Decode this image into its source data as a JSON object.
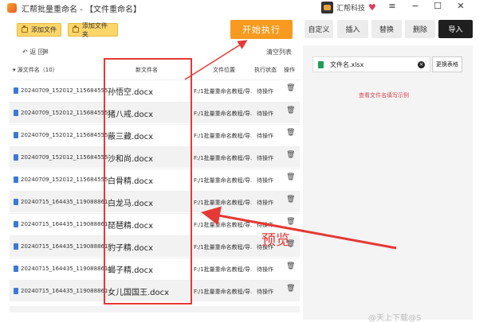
{
  "window": {
    "title": "汇帮批量重命名 - 【文件重命名】",
    "brand": "汇帮科技",
    "controls": {
      "menu": "≡",
      "minimize": "−",
      "maximize": "☐",
      "close": "✕"
    }
  },
  "toolbar": {
    "add_file": "添加文件",
    "add_folder": "添加文件夹",
    "start": "开始执行"
  },
  "tabs": [
    "自定义",
    "插入",
    "替换",
    "删除",
    "导入"
  ],
  "list": {
    "back": "返 回",
    "grid_icon": "⊞",
    "clear": "清空列表",
    "headers": {
      "original": "▾ 源文件名（10）",
      "new_name": "新文件名",
      "location": "文件位置",
      "status": "执行状态",
      "action": "操作"
    },
    "rows": [
      {
        "original": "20240709_152012_115684555",
        "new_name": "孙悟空.docx",
        "location": "F:/1批量重命名教程/导.",
        "status": "待操作",
        "trash": "🗑"
      },
      {
        "original": "20240709_152012_115684555",
        "new_name": "猪八戒.docx",
        "location": "F:/1批量重命名教程/导.",
        "status": "待操作",
        "trash": "🗑"
      },
      {
        "original": "20240709_152012_115684555",
        "new_name": "蔽三藏.docx",
        "location": "F:/1批量重命名教程/导.",
        "status": "待操作",
        "trash": "🗑"
      },
      {
        "original": "20240709_152012_115684555",
        "new_name": "沙和尚.docx",
        "location": "F:/1批量重命名教程/导.",
        "status": "待操作",
        "trash": "🗑"
      },
      {
        "original": "20240709_152012_115684555",
        "new_name": "白骨精.docx",
        "location": "F:/1批量重命名教程/导.",
        "status": "待操作",
        "trash": "🗑"
      },
      {
        "original": "20240715_164435_119088861",
        "new_name": "白龙马.docx",
        "location": "F:/1批量重命名教程/导.",
        "status": "待操作",
        "trash": "🗑"
      },
      {
        "original": "20240715_164435_119088861",
        "new_name": "琵琶精.docx",
        "location": "F:/1批量重命名教程/导.",
        "status": "待操作",
        "trash": "🗑"
      },
      {
        "original": "20240715_164435_119088861",
        "new_name": "豹子精.docx",
        "location": "F:/1批量重命名教程/导.",
        "status": "待操作",
        "trash": "🗑"
      },
      {
        "original": "20240715_164435_119088861",
        "new_name": "蝎子精.docx",
        "location": "F:/1批量重命名教程/导.",
        "status": "待操作",
        "trash": "🗑"
      },
      {
        "original": "20240715_164435_119088861",
        "new_name": "女儿国国王.docx",
        "location": "F:/1批量重命名教程/导.",
        "status": "待操作",
        "trash": "🗑"
      }
    ]
  },
  "import_panel": {
    "file_name": "文件名.xlsx",
    "replace_button": "更换表格",
    "sample_link": "查看文件名填写示例"
  },
  "annotation": {
    "preview_label": "预览",
    "color": "#e53935"
  },
  "watermark": "@天上下载@S"
}
